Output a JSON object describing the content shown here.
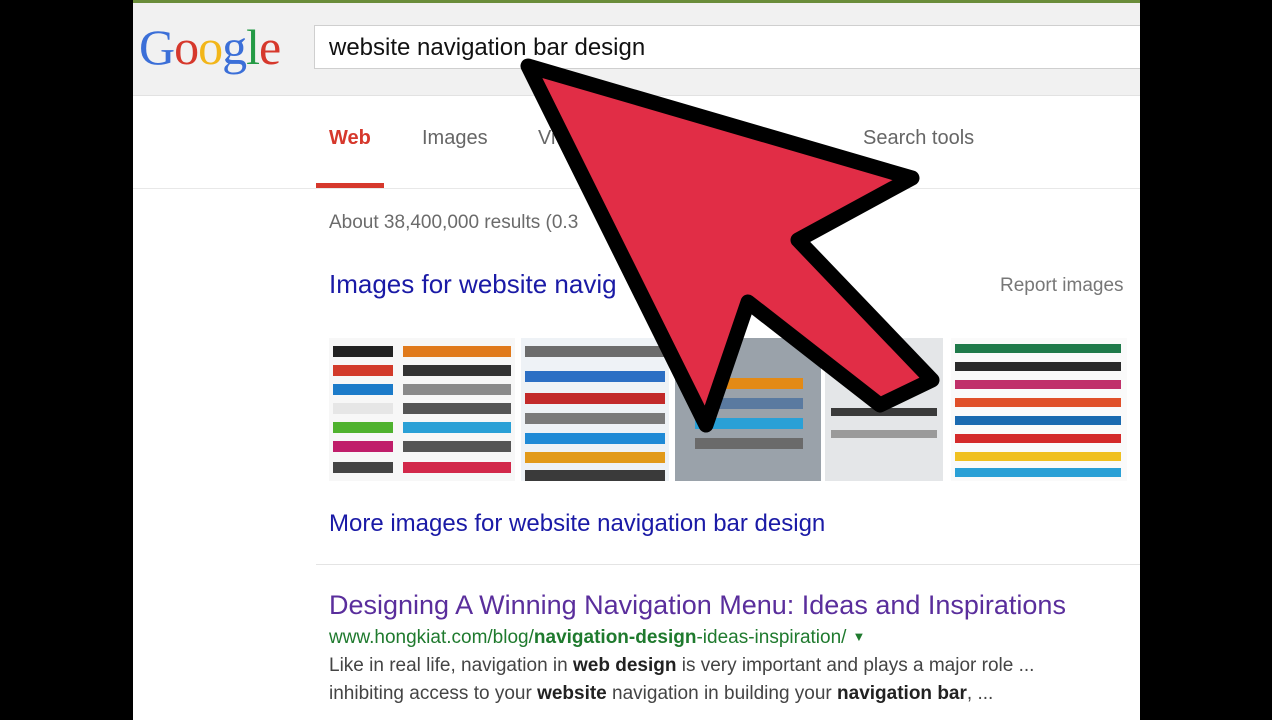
{
  "logo": {
    "text": "Google"
  },
  "search": {
    "value": "website navigation bar design"
  },
  "tabs": [
    {
      "label": "Web"
    },
    {
      "label": "Images"
    },
    {
      "label": "Vi"
    },
    {
      "label": "Search tools"
    }
  ],
  "stats": {
    "text": "About 38,400,000 results (0.3"
  },
  "images": {
    "heading": "Images for website navig",
    "report": "Report images",
    "more": "More images for website navigation bar design"
  },
  "result": {
    "title": "Designing A Winning Navigation Menu: Ideas and Inspirations",
    "url_prefix": "www.hongkiat.com/blog/",
    "url_bold_1": "navigation-design",
    "url_mid": "-ideas-inspiration/",
    "snippet1_a": "Like in real life, navigation in ",
    "snippet1_b": "web design",
    "snippet1_c": " is very important and plays a major role ...",
    "snippet2_a": "inhibiting access to your ",
    "snippet2_b": "website",
    "snippet2_c": " navigation in building your ",
    "snippet2_d": "navigation bar",
    "snippet2_e": ", ..."
  },
  "colors": {
    "arrow_fill": "#e12d46",
    "active_tab": "#d6382c",
    "link": "#1a1aa6",
    "visited": "#5a2e9c",
    "url": "#1f7a2e"
  },
  "icons": {
    "url_caret": "triangle-down",
    "overlay": "cursor-arrow"
  }
}
